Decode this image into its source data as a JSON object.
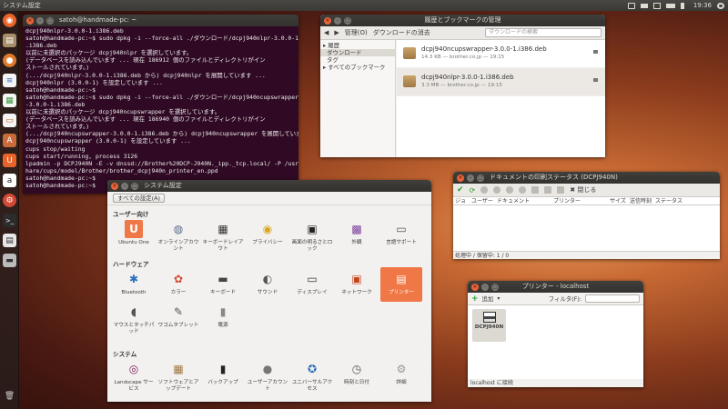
{
  "top_panel": {
    "app_title": "システム設定",
    "clock": "19:36"
  },
  "launcher": {
    "icons": [
      "dash-icon",
      "files-icon",
      "firefox-icon",
      "writer-icon",
      "calc-icon",
      "impress-icon",
      "software-center-icon",
      "ubuntu-one-icon",
      "amazon-icon",
      "settings-icon",
      "terminal-icon",
      "printer-icon",
      "drive-icon",
      "trash-icon"
    ]
  },
  "terminal": {
    "title": "satoh@handmade-pc: ~",
    "lines": [
      "dcpj940nlpr-3.0.0-1.i386.deb",
      "satoh@handmade-pc:~$ sudo dpkg -i --force-all ./ダウンロード/dcpj940nlpr-3.0.0-1",
      ".i386.deb",
      "以前に未選択のパッケージ dcpj940nlpr を選択しています。",
      "(データベースを読み込んでいます ... 現在 186912 個のファイルとディレクトリがイン",
      "ストールされています。)",
      "(.../dcpj940nlpr-3.0.0-1.i386.deb から) dcpj940nlpr を展開しています ...",
      "dcpj940nlpr (3.0.0-1) を設定しています ...",
      "satoh@handmade-pc:~$",
      "satoh@handmade-pc:~$ sudo dpkg -i --force-all ./ダウンロード/dcpj940ncupswrapper",
      "-3.0.0-1.i386.deb",
      "以前に未選択のパッケージ dcpj940ncupswrapper を選択しています。",
      "(データベースを読み込んでいます ... 現在 186940 個のファイルとディレクトリがイン",
      "ストールされています。)",
      "(.../dcpj940ncupswrapper-3.0.0-1.i386.deb から) dcpj940ncupswrapper を展開しています ...",
      "dcpj940ncupswrapper (3.0.0-1) を設定しています ...",
      "cups stop/waiting",
      "cups start/running, process 3126",
      "lpadmin -p DCPJ940N -E -v dnssd://Brother%20DCP-J940N._ipp._tcp.local/ -P /usr/s",
      "hare/cups/model/Brother/brother_dcpj940n_printer_en.ppd",
      "satoh@handmade-pc:~$",
      "satoh@handmade-pc:~$ "
    ]
  },
  "history": {
    "title": "履歴とブックマークの管理",
    "toolbar": {
      "manage": "管理(O)",
      "clear": "ダウンロードの消去",
      "search_placeholder": "ダウンロードの検索"
    },
    "sidebar": [
      "履歴",
      "ダウンロード",
      "タグ",
      "すべてのブックマーク"
    ],
    "downloads": [
      {
        "name": "dcpj940ncupswrapper-3.0.0-1.i386.deb",
        "meta": "14.3 KB — brother.co.jp — 19:15"
      },
      {
        "name": "dcpj940nlpr-3.0.0-1.i386.deb",
        "meta": "3.3 MB — brother.co.jp — 19:15"
      }
    ]
  },
  "print_status": {
    "title": "ドキュメントの印刷ステータス (DCPJ940N)",
    "close_label": "閉じる",
    "columns": [
      "ジョブ",
      "ユーザー",
      "ドキュメント",
      "プリンター",
      "サイズ",
      "送信時刻",
      "ステータス"
    ],
    "status": "処理中 / 保留中: 1 / 0"
  },
  "printers": {
    "title": "プリンター - localhost",
    "add_label": "追加",
    "filter_label": "フィルタ(F):",
    "printer_name": "DCPJ940N",
    "status": "localhost に接続"
  },
  "settings": {
    "title": "システム設定",
    "all_settings_button": "すべての設定(A)",
    "sections": [
      {
        "title": "ユーザー向け",
        "items": [
          "Ubuntu One",
          "オンラインアカウント",
          "キーボードレイアウト",
          "プライバシー",
          "画面の明るさとロック",
          "外観",
          "言語サポート"
        ]
      },
      {
        "title": "ハードウェア",
        "items": [
          "Bluetooth",
          "カラー",
          "キーボード",
          "サウンド",
          "ディスプレイ",
          "ネットワーク",
          "プリンター",
          "マウスとタッチパッド",
          "ワコムタブレット",
          "電源"
        ]
      },
      {
        "title": "システム",
        "items": [
          "Landscape サービス",
          "ソフトウェアとアップデート",
          "バックアップ",
          "ユーザーアカウント",
          "ユニバーサルアクセス",
          "時刻と日付",
          "詳細"
        ]
      }
    ]
  },
  "colors": {
    "accent": "#f07746",
    "terminal_bg": "#300a24"
  }
}
